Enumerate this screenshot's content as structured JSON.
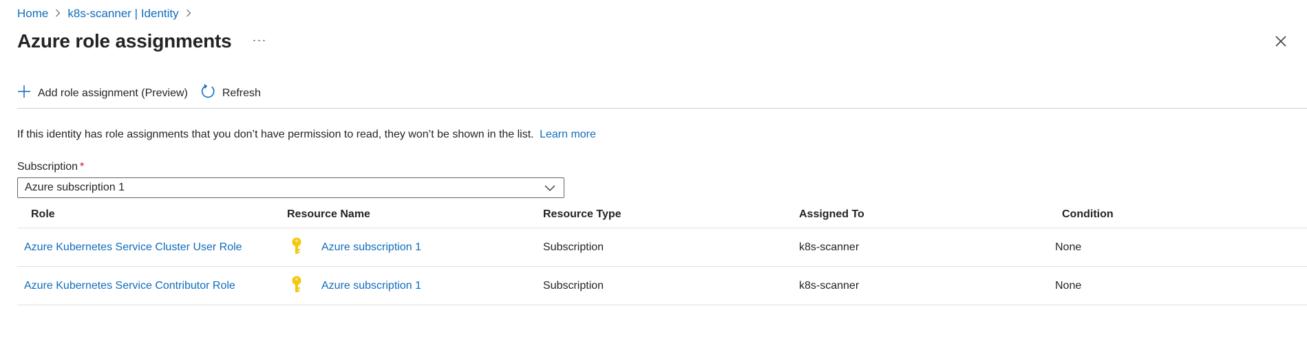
{
  "breadcrumb": {
    "home": "Home",
    "identity": "k8s-scanner | Identity"
  },
  "header": {
    "title": "Azure role assignments",
    "more": "···"
  },
  "toolbar": {
    "add_label": "Add role assignment (Preview)",
    "refresh_label": "Refresh"
  },
  "info": {
    "text": "If this identity has role assignments that you don’t have permission to read, they won’t be shown in the list.",
    "link": "Learn more"
  },
  "subscription": {
    "label": "Subscription",
    "required_mark": "*",
    "selected": "Azure subscription 1"
  },
  "table": {
    "headers": {
      "role": "Role",
      "resource_name": "Resource Name",
      "resource_type": "Resource Type",
      "assigned_to": "Assigned To",
      "condition": "Condition"
    },
    "rows": [
      {
        "role": "Azure Kubernetes Service Cluster User Role",
        "resource_name": "Azure subscription 1",
        "resource_type": "Subscription",
        "assigned_to": "k8s-scanner",
        "condition": "None"
      },
      {
        "role": "Azure Kubernetes Service Contributor Role",
        "resource_name": "Azure subscription 1",
        "resource_type": "Subscription",
        "assigned_to": "k8s-scanner",
        "condition": "None"
      }
    ]
  },
  "icons": {
    "chevron": "chevron-right-icon",
    "more": "more-icon",
    "close": "close-icon",
    "add": "plus-icon",
    "refresh": "refresh-icon",
    "dropdown": "chevron-down-icon",
    "key": "key-icon"
  },
  "colors": {
    "link": "#0f6cbd",
    "required": "#c50f1f",
    "key": "#f2c811"
  }
}
